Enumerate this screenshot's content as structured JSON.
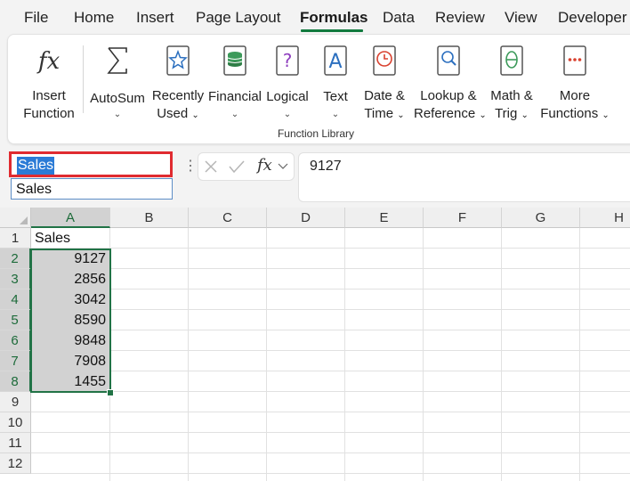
{
  "menu": {
    "tabs": [
      "File",
      "Home",
      "Insert",
      "Page Layout",
      "Formulas",
      "Data",
      "Review",
      "View",
      "Developer"
    ],
    "active": "Formulas"
  },
  "ribbon": {
    "group_label": "Function Library",
    "buttons": [
      {
        "line1": "Insert",
        "line2": "Function",
        "icon": "fx-icon"
      },
      {
        "line1": "AutoSum",
        "line2": "",
        "icon": "sigma-icon",
        "dropdown": true
      },
      {
        "line1": "Recently",
        "line2": "Used",
        "icon": "star-book-icon",
        "dropdown": true
      },
      {
        "line1": "Financial",
        "line2": "",
        "icon": "coins-book-icon",
        "dropdown": true
      },
      {
        "line1": "Logical",
        "line2": "",
        "icon": "question-book-icon",
        "dropdown": true
      },
      {
        "line1": "Text",
        "line2": "",
        "icon": "letter-a-book-icon",
        "dropdown": true
      },
      {
        "line1": "Date &",
        "line2": "Time",
        "icon": "clock-book-icon",
        "dropdown": true
      },
      {
        "line1": "Lookup &",
        "line2": "Reference",
        "icon": "magnifier-book-icon",
        "dropdown": true
      },
      {
        "line1": "Math &",
        "line2": "Trig",
        "icon": "theta-book-icon",
        "dropdown": true
      },
      {
        "line1": "More",
        "line2": "Functions",
        "icon": "dots-book-icon",
        "dropdown": true
      }
    ]
  },
  "formula_bar": {
    "name_box": "Sales",
    "name_dropdown_item": "Sales",
    "fx_label": "fx",
    "value": "9127"
  },
  "sheet": {
    "columns": [
      "A",
      "B",
      "C",
      "D",
      "E",
      "F",
      "G",
      "H"
    ],
    "rows": [
      "1",
      "2",
      "3",
      "4",
      "5",
      "6",
      "7",
      "8",
      "9",
      "10",
      "11",
      "12"
    ],
    "header": "Sales",
    "values": [
      "9127",
      "2856",
      "3042",
      "8590",
      "9848",
      "7908",
      "1455"
    ]
  },
  "colors": {
    "accent": "#217346",
    "selection_outline": "#e02b30",
    "name_highlight": "#2b7bd6"
  }
}
